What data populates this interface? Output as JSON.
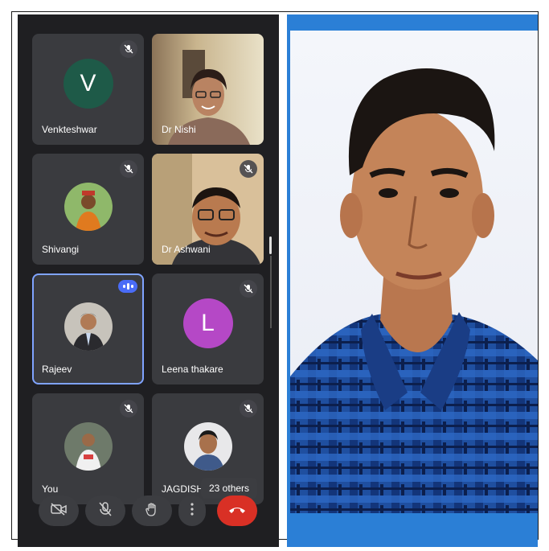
{
  "participants": [
    {
      "name": "Venkteshwar",
      "initial": "V",
      "avatar_color": "#1e5a48",
      "muted": true
    },
    {
      "name": "Dr Nishi",
      "muted": false,
      "video": true
    },
    {
      "name": "Shivangi",
      "muted": true
    },
    {
      "name": "Dr Ashwani",
      "muted": true,
      "video": true
    },
    {
      "name": "Rajeev",
      "speaking": true
    },
    {
      "name": "Leena thakare",
      "initial": "L",
      "avatar_color": "#b548c6",
      "muted": true
    },
    {
      "name": "You",
      "muted": true
    },
    {
      "name": "JAGDISH",
      "muted": true
    }
  ],
  "others_label": "23 others",
  "controls": {
    "icons": [
      "camera-off-icon",
      "mic-off-icon",
      "raise-hand-icon",
      "more-options-icon",
      "end-call-icon"
    ]
  }
}
